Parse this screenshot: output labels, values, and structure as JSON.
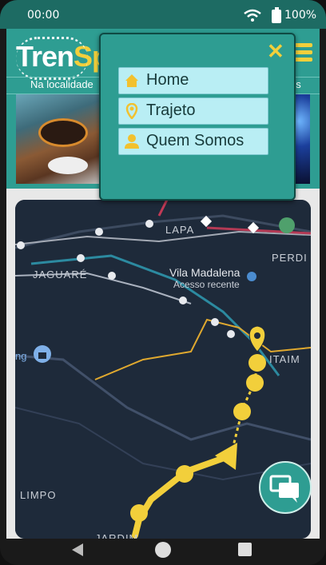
{
  "status": {
    "time": "00:00",
    "battery": "100%"
  },
  "header": {
    "logo_part1": "Tren",
    "logo_part2": "Sp",
    "nav_left": "Na localidade",
    "nav_right": "os"
  },
  "menu": {
    "close_icon": "close-icon",
    "items": [
      {
        "label": "Home",
        "icon": "home-icon"
      },
      {
        "label": "Trajeto",
        "icon": "location-pin-icon"
      },
      {
        "label": "Quem Somos",
        "icon": "person-icon"
      }
    ]
  },
  "map": {
    "labels": [
      "LAPA",
      "JAGUARÉ",
      "Vila Madalena",
      "Acesso recente",
      "PERDI",
      "ITAIM",
      "LIMPO",
      "JARDIM",
      "ng"
    ]
  },
  "colors": {
    "accent": "#2e9d92",
    "highlight": "#f2cf3b",
    "menu_item_bg": "#b9eef4",
    "map_bg": "#1e2a3a"
  }
}
